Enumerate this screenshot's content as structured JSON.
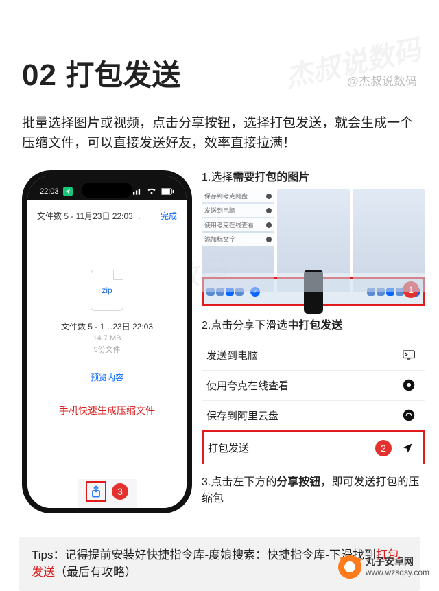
{
  "header": {
    "num": "02",
    "title": "打包发送",
    "author": "@杰叔说数码"
  },
  "intro": "批量选择图片或视频，点击分享按钮，选择打包发送，就会生成一个压缩文件，可以直接发送好友，效率直接拉满！",
  "phone": {
    "time": "22:03",
    "sheet_title": "文件数 5 - 11月23日 22:03",
    "done": "完成",
    "zip_label": "zip",
    "file_name": "文件数 5 - 1…23日 22:03",
    "file_size": "14.7 MB",
    "file_count": "5份文件",
    "preview": "预览内容",
    "caption": "手机快速生成压缩文件",
    "badge": "3"
  },
  "steps": {
    "s1a": "1.选择",
    "s1b": "需要打包的图片",
    "s2a": "2.点击分享下滑选中",
    "s2b": "打包发送",
    "s3a": "3.点击左下方的",
    "s3b": "分享按钮",
    "s3c": "，即可发送打包的压缩包",
    "badge1": "1",
    "badge2": "2"
  },
  "shot1_menu": {
    "i1": "保存到考克网盘",
    "i2": "发送到电脑",
    "i3": "使用考克在线查看",
    "i4": "添加标文字"
  },
  "menu": {
    "r1": "发送到电脑",
    "r2": "使用夸克在线查看",
    "r3": "保存到阿里云盘",
    "r4": "打包发送"
  },
  "tips": {
    "lead": "Tips：",
    "text1": "记得提前安装好快捷指令库-度娘搜索：快捷指令库-下滑找到",
    "text2": "打包发送",
    "text3": "（最后有攻略）"
  },
  "footer": {
    "name": "丸子安卓网",
    "url": "www.wzsqsy.com"
  },
  "watermark": "杰叔说数码"
}
